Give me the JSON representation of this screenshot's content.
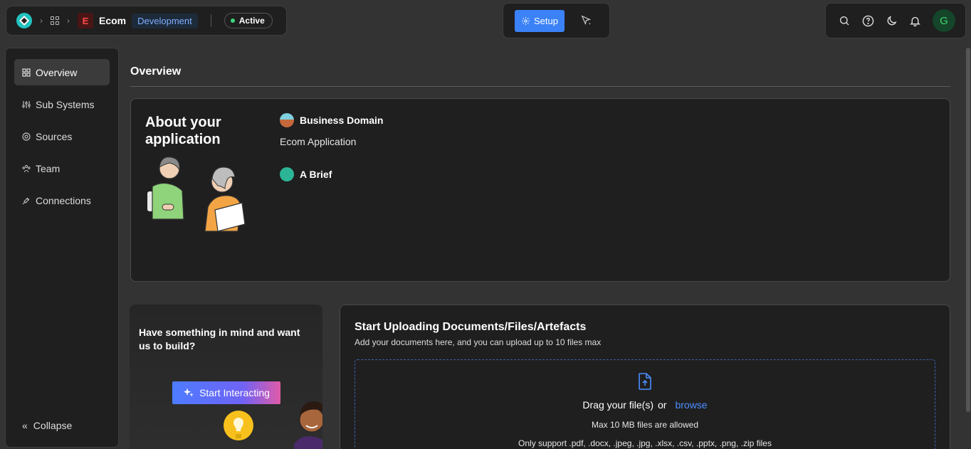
{
  "header": {
    "project_initial": "E",
    "project_name": "Ecom",
    "environment": "Development",
    "status": "Active",
    "setup_label": "Setup",
    "avatar_initial": "G"
  },
  "sidebar": {
    "items": [
      {
        "label": "Overview",
        "icon": "grid-icon",
        "active": true
      },
      {
        "label": "Sub Systems",
        "icon": "sliders-icon",
        "active": false
      },
      {
        "label": "Sources",
        "icon": "source-icon",
        "active": false
      },
      {
        "label": "Team",
        "icon": "team-icon",
        "active": false
      },
      {
        "label": "Connections",
        "icon": "plug-icon",
        "active": false
      }
    ],
    "collapse_label": "Collapse"
  },
  "main": {
    "title": "Overview",
    "about": {
      "heading": "About your application",
      "business_domain_label": "Business Domain",
      "business_domain_value": "Ecom Application",
      "brief_label": "A Brief"
    },
    "interact": {
      "text": "Have something in mind and want us to build?",
      "button_label": "Start Interacting"
    },
    "upload": {
      "title": "Start Uploading Documents/Files/Artefacts",
      "subtitle": "Add your documents here, and you can upload up to 10 files max",
      "drag_text": "Drag your file(s)",
      "or_text": "or",
      "browse_text": "browse",
      "max_text": "Max 10 MB files are allowed",
      "support_text": "Only support .pdf, .docx, .jpeg, .jpg, .xlsx, .csv, .pptx, .png, .zip files"
    }
  },
  "colors": {
    "accent": "#3b82f6",
    "status": "#3ed67a",
    "background": "#333333",
    "card": "#1f1f1f"
  }
}
